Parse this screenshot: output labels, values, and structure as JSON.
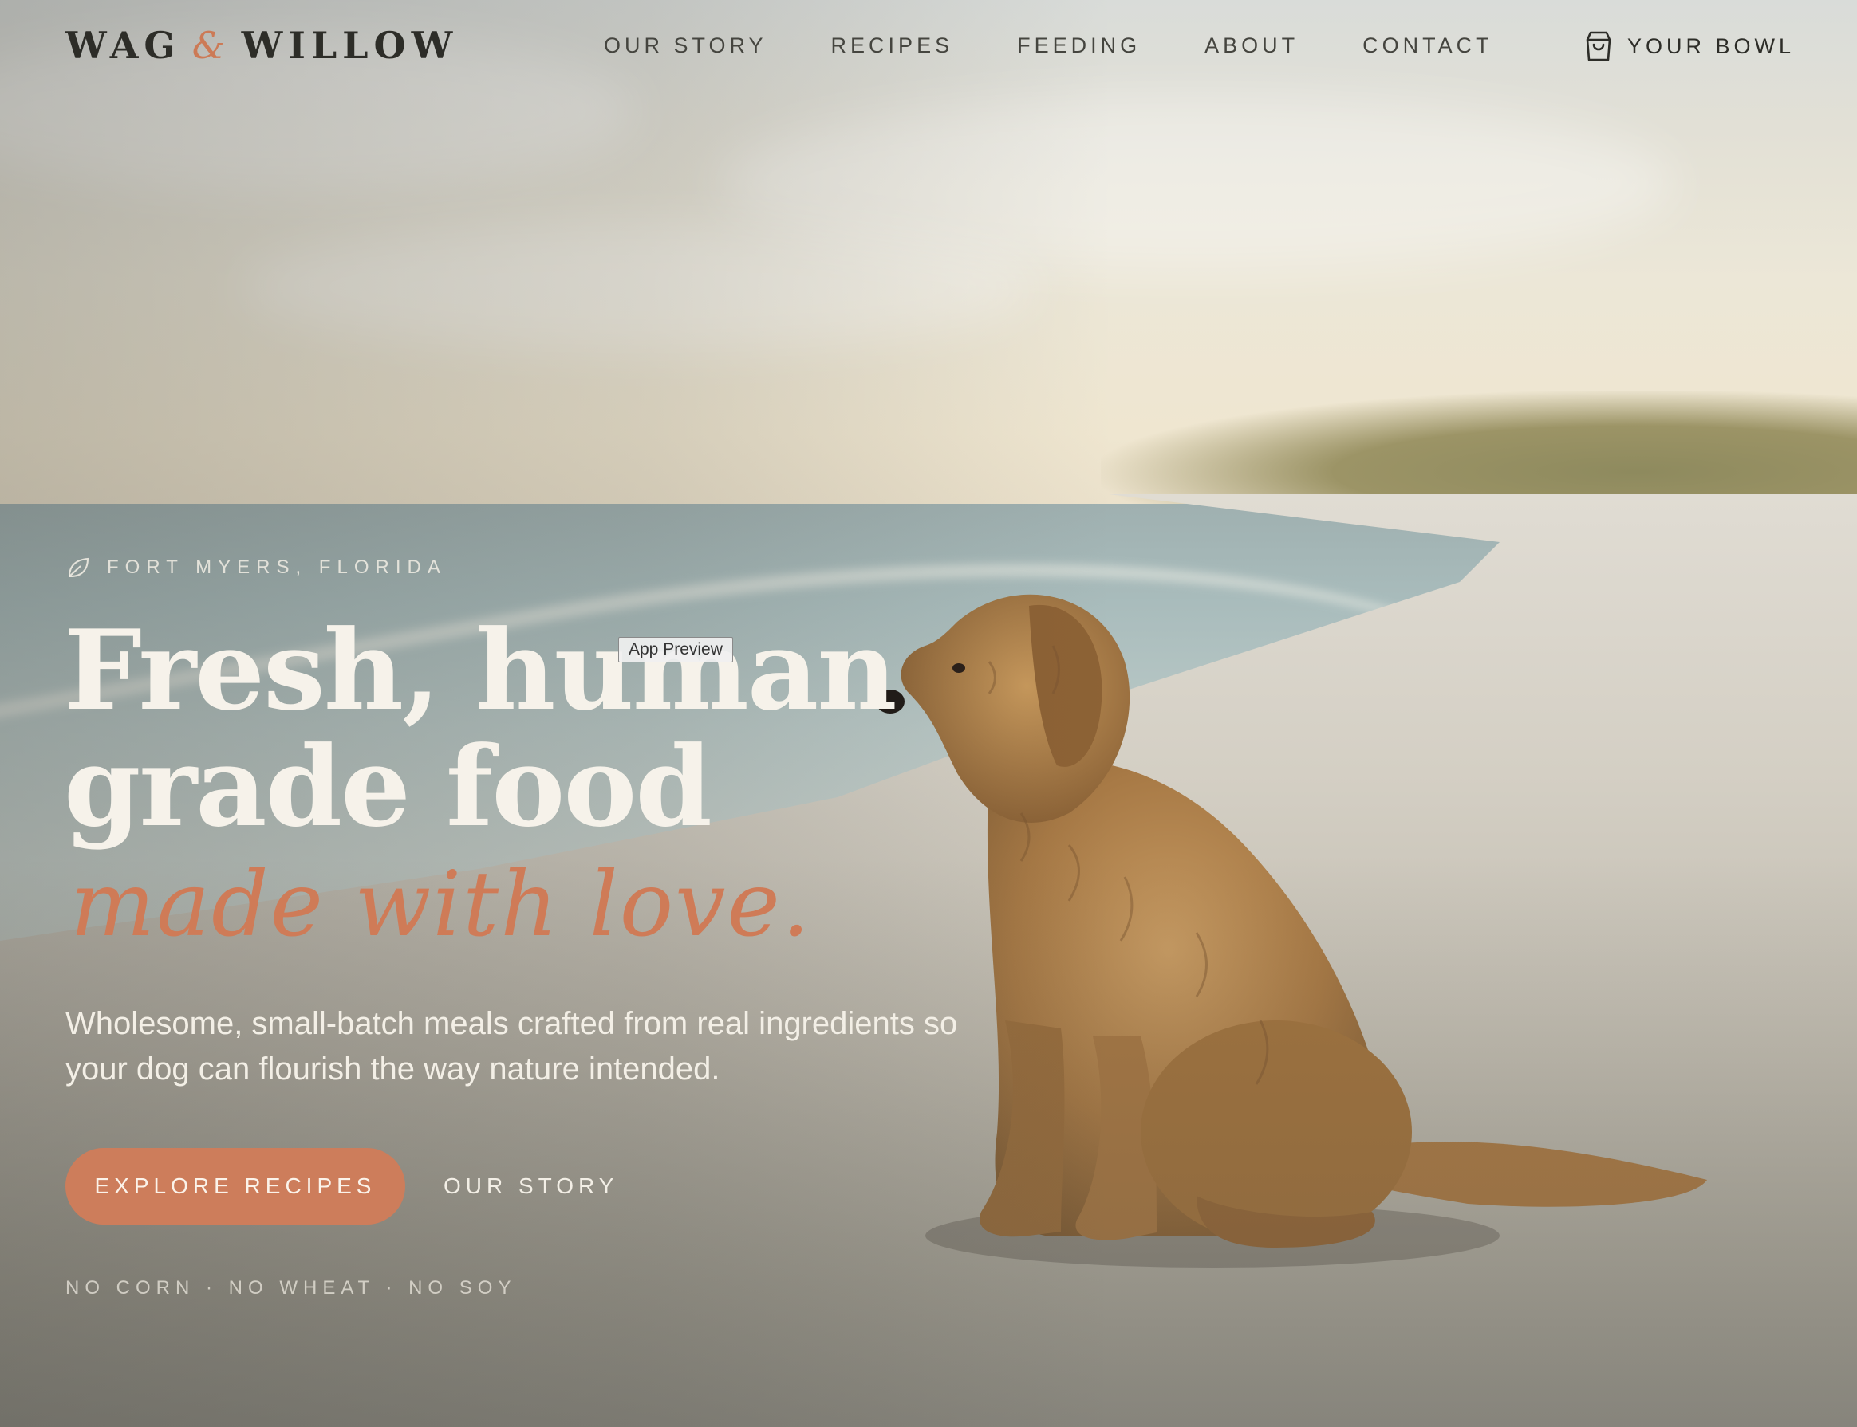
{
  "brand": {
    "name_part1": "WAG",
    "ampersand": "&",
    "name_part2": "WILLOW",
    "accent_color": "#cd7d5b"
  },
  "nav": {
    "items": [
      {
        "label": "OUR STORY"
      },
      {
        "label": "RECIPES"
      },
      {
        "label": "FEEDING"
      },
      {
        "label": "ABOUT"
      },
      {
        "label": "CONTACT"
      }
    ]
  },
  "cart": {
    "label": "YOUR BOWL",
    "icon": "shopping-bag-icon"
  },
  "hero": {
    "location": "FORT MYERS, FLORIDA",
    "location_icon": "leaf-icon",
    "headline_line1": "Fresh, human",
    "headline_line2": "grade food",
    "script_line": "made with love.",
    "subcopy": "Wholesome, small-batch meals crafted from real ingredients so your dog can flourish the way nature intended.",
    "primary_cta": "EXPLORE RECIPES",
    "secondary_cta": "OUR STORY",
    "assurances": "NO CORN · NO WHEAT · NO SOY"
  },
  "overlay": {
    "preview_tag": "App Preview"
  },
  "background": {
    "image_subject": "golden doodle dog sitting on a beach at sunset"
  }
}
